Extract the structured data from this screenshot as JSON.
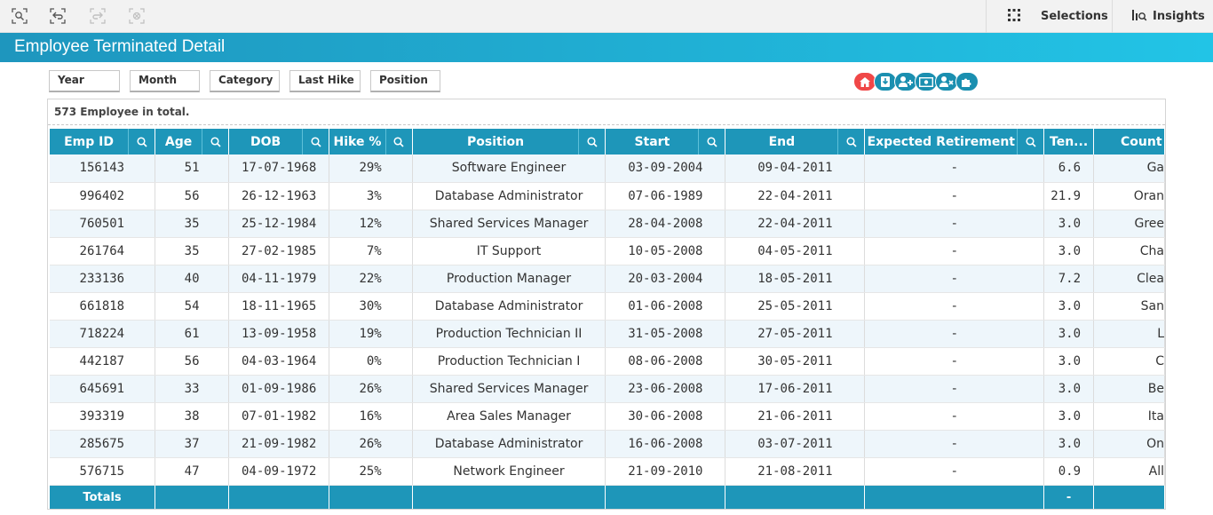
{
  "toolbar": {
    "buttons": [
      "smart-search-icon",
      "step-back-icon",
      "step-forward-icon",
      "clear-selections-icon"
    ],
    "selections_label": "Selections",
    "insights_label": "Insights"
  },
  "sheet_title": "Employee Terminated Detail",
  "filters": [
    "Year",
    "Month",
    "Category",
    "Last Hike",
    "Position"
  ],
  "nav_pills": [
    "home-icon",
    "download-icon",
    "add-user-icon",
    "money-icon",
    "remove-user-icon",
    "puzzle-icon"
  ],
  "table": {
    "total_text": "573 Employee in total.",
    "columns": [
      "Emp ID",
      "Age",
      "DOB",
      "Hike %",
      "Position",
      "Start",
      "End",
      "Expected Retirement",
      "Ten...",
      "Count"
    ],
    "rows": [
      [
        "156143",
        "51",
        "17-07-1968",
        "29%",
        "Software Engineer",
        "03-09-2004",
        "09-04-2011",
        "-",
        "6.6",
        "Ga"
      ],
      [
        "996402",
        "56",
        "26-12-1963",
        "3%",
        "Database Administrator",
        "07-06-1989",
        "22-04-2011",
        "-",
        "21.9",
        "Oran"
      ],
      [
        "760501",
        "35",
        "25-12-1984",
        "12%",
        "Shared Services Manager",
        "28-04-2008",
        "22-04-2011",
        "-",
        "3.0",
        "Gree"
      ],
      [
        "261764",
        "35",
        "27-02-1985",
        "7%",
        "IT Support",
        "10-05-2008",
        "04-05-2011",
        "-",
        "3.0",
        "Cha"
      ],
      [
        "233136",
        "40",
        "04-11-1979",
        "22%",
        "Production Manager",
        "20-03-2004",
        "18-05-2011",
        "-",
        "7.2",
        "Clea"
      ],
      [
        "661818",
        "54",
        "18-11-1965",
        "30%",
        "Database Administrator",
        "01-06-2008",
        "25-05-2011",
        "-",
        "3.0",
        "San"
      ],
      [
        "718224",
        "61",
        "13-09-1958",
        "19%",
        "Production Technician II",
        "31-05-2008",
        "27-05-2011",
        "-",
        "3.0",
        "L"
      ],
      [
        "442187",
        "56",
        "04-03-1964",
        "0%",
        "Production Technician I",
        "08-06-2008",
        "30-05-2011",
        "-",
        "3.0",
        "C"
      ],
      [
        "645691",
        "33",
        "01-09-1986",
        "26%",
        "Shared Services Manager",
        "23-06-2008",
        "17-06-2011",
        "-",
        "3.0",
        "Be"
      ],
      [
        "393319",
        "38",
        "07-01-1982",
        "16%",
        "Area Sales Manager",
        "30-06-2008",
        "21-06-2011",
        "-",
        "3.0",
        "Ita"
      ],
      [
        "285675",
        "37",
        "21-09-1982",
        "26%",
        "Database Administrator",
        "16-06-2008",
        "03-07-2011",
        "-",
        "3.0",
        "On"
      ],
      [
        "576715",
        "47",
        "04-09-1972",
        "25%",
        "Network Engineer",
        "21-09-2010",
        "21-08-2011",
        "-",
        "0.9",
        "All"
      ]
    ],
    "totals": [
      "Totals",
      "",
      "",
      "",
      "",
      "",
      "",
      "",
      "-",
      ""
    ]
  }
}
